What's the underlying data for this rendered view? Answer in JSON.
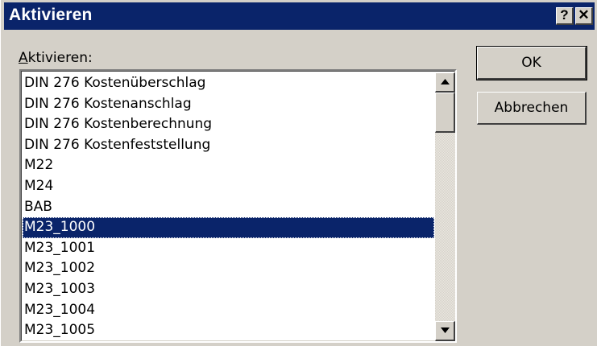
{
  "window": {
    "title": "Aktivieren",
    "help_glyph": "?",
    "close_glyph": "✕",
    "title_bar_color": "#0a246a"
  },
  "list": {
    "label": "Aktivieren:",
    "label_accesskey": "A",
    "label_rest": "ktivieren:",
    "items": [
      "DIN 276 Kostenüberschlag",
      "DIN 276 Kostenanschlag",
      "DIN 276 Kostenberechnung",
      "DIN 276 Kostenfeststellung",
      "M22",
      "M24",
      "BAB",
      "M23_1000",
      "M23_1001",
      "M23_1002",
      "M23_1003",
      "M23_1004",
      "M23_1005"
    ],
    "selected_item": "M23_1000",
    "selection_color": "#0a246a"
  },
  "buttons": {
    "ok": "OK",
    "cancel": "Abbrechen"
  },
  "icons": {
    "help": "help-icon",
    "close": "close-icon",
    "scroll_up": "arrow-up-icon",
    "scroll_down": "arrow-down-icon"
  }
}
